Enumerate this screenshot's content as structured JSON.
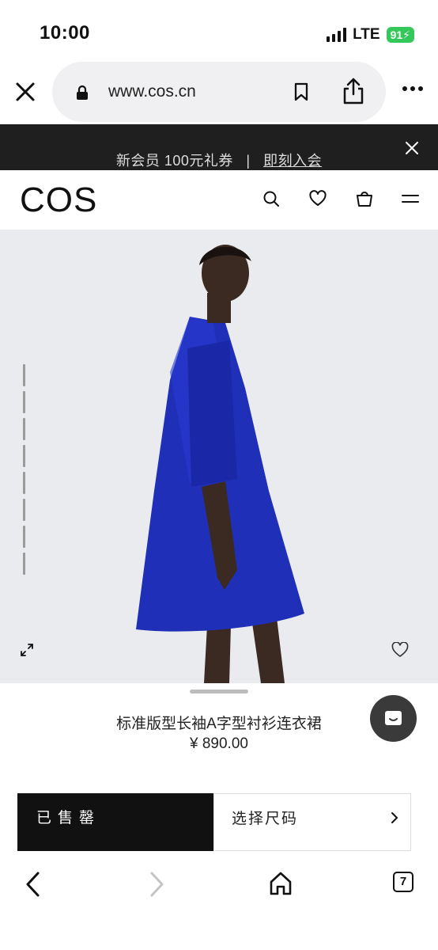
{
  "status": {
    "time": "10:00",
    "network": "LTE",
    "battery": "91"
  },
  "browser": {
    "url": "www.cos.cn",
    "tab_count": "7"
  },
  "promo": {
    "text": "新会员 100元礼券",
    "separator": "|",
    "link": "即刻入会"
  },
  "header": {
    "logo": "COS",
    "icons": [
      "search-icon",
      "heart-icon",
      "bag-icon",
      "menu-icon"
    ]
  },
  "product": {
    "name": "标准版型长袖A字型衬衫连衣裙",
    "price": "¥ 890.00",
    "sold_out_label": "已售罄",
    "size_label": "选择尺码",
    "image_color": "#1f2fb8"
  }
}
